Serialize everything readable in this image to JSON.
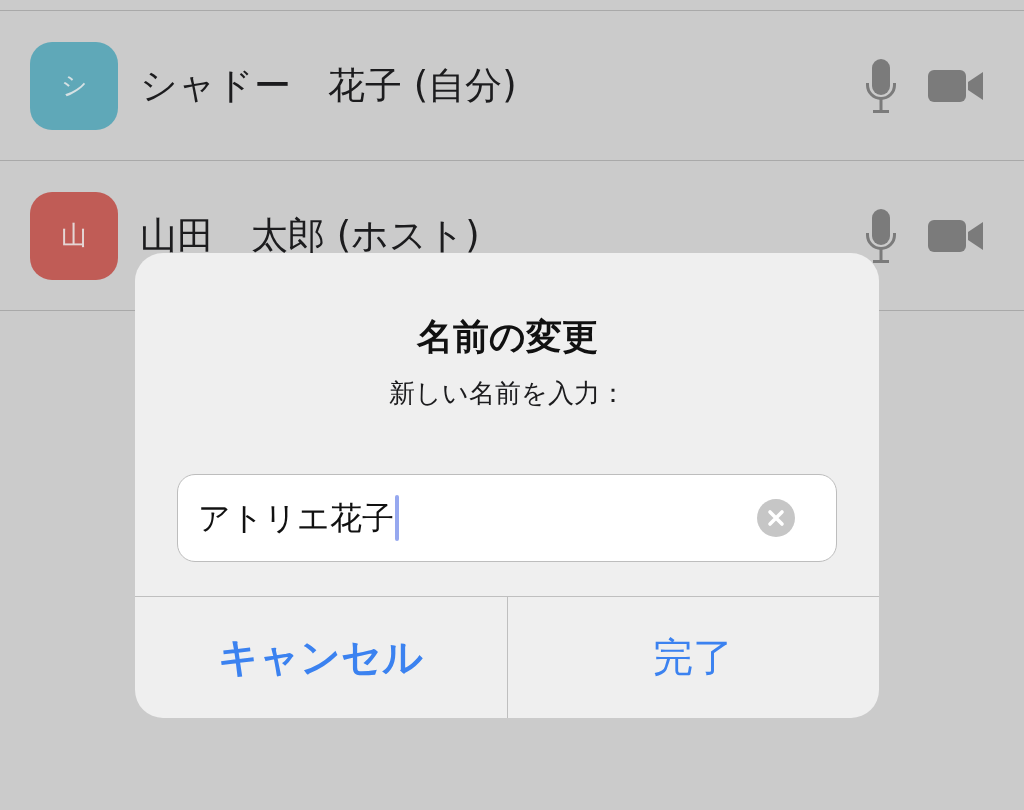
{
  "participants": [
    {
      "initial": "シ",
      "name": "シャドー　花子 (自分)",
      "color": "#5fa8b8"
    },
    {
      "initial": "山",
      "name": "山田　太郎 (ホスト)",
      "color": "#c05c56"
    }
  ],
  "dialog": {
    "title": "名前の変更",
    "message": "新しい名前を入力：",
    "field": {
      "value": "アトリエ花子",
      "focused": true
    },
    "buttons": [
      {
        "label": "キャンセル",
        "kind": "cancel"
      },
      {
        "label": "完了",
        "kind": "default"
      }
    ]
  }
}
